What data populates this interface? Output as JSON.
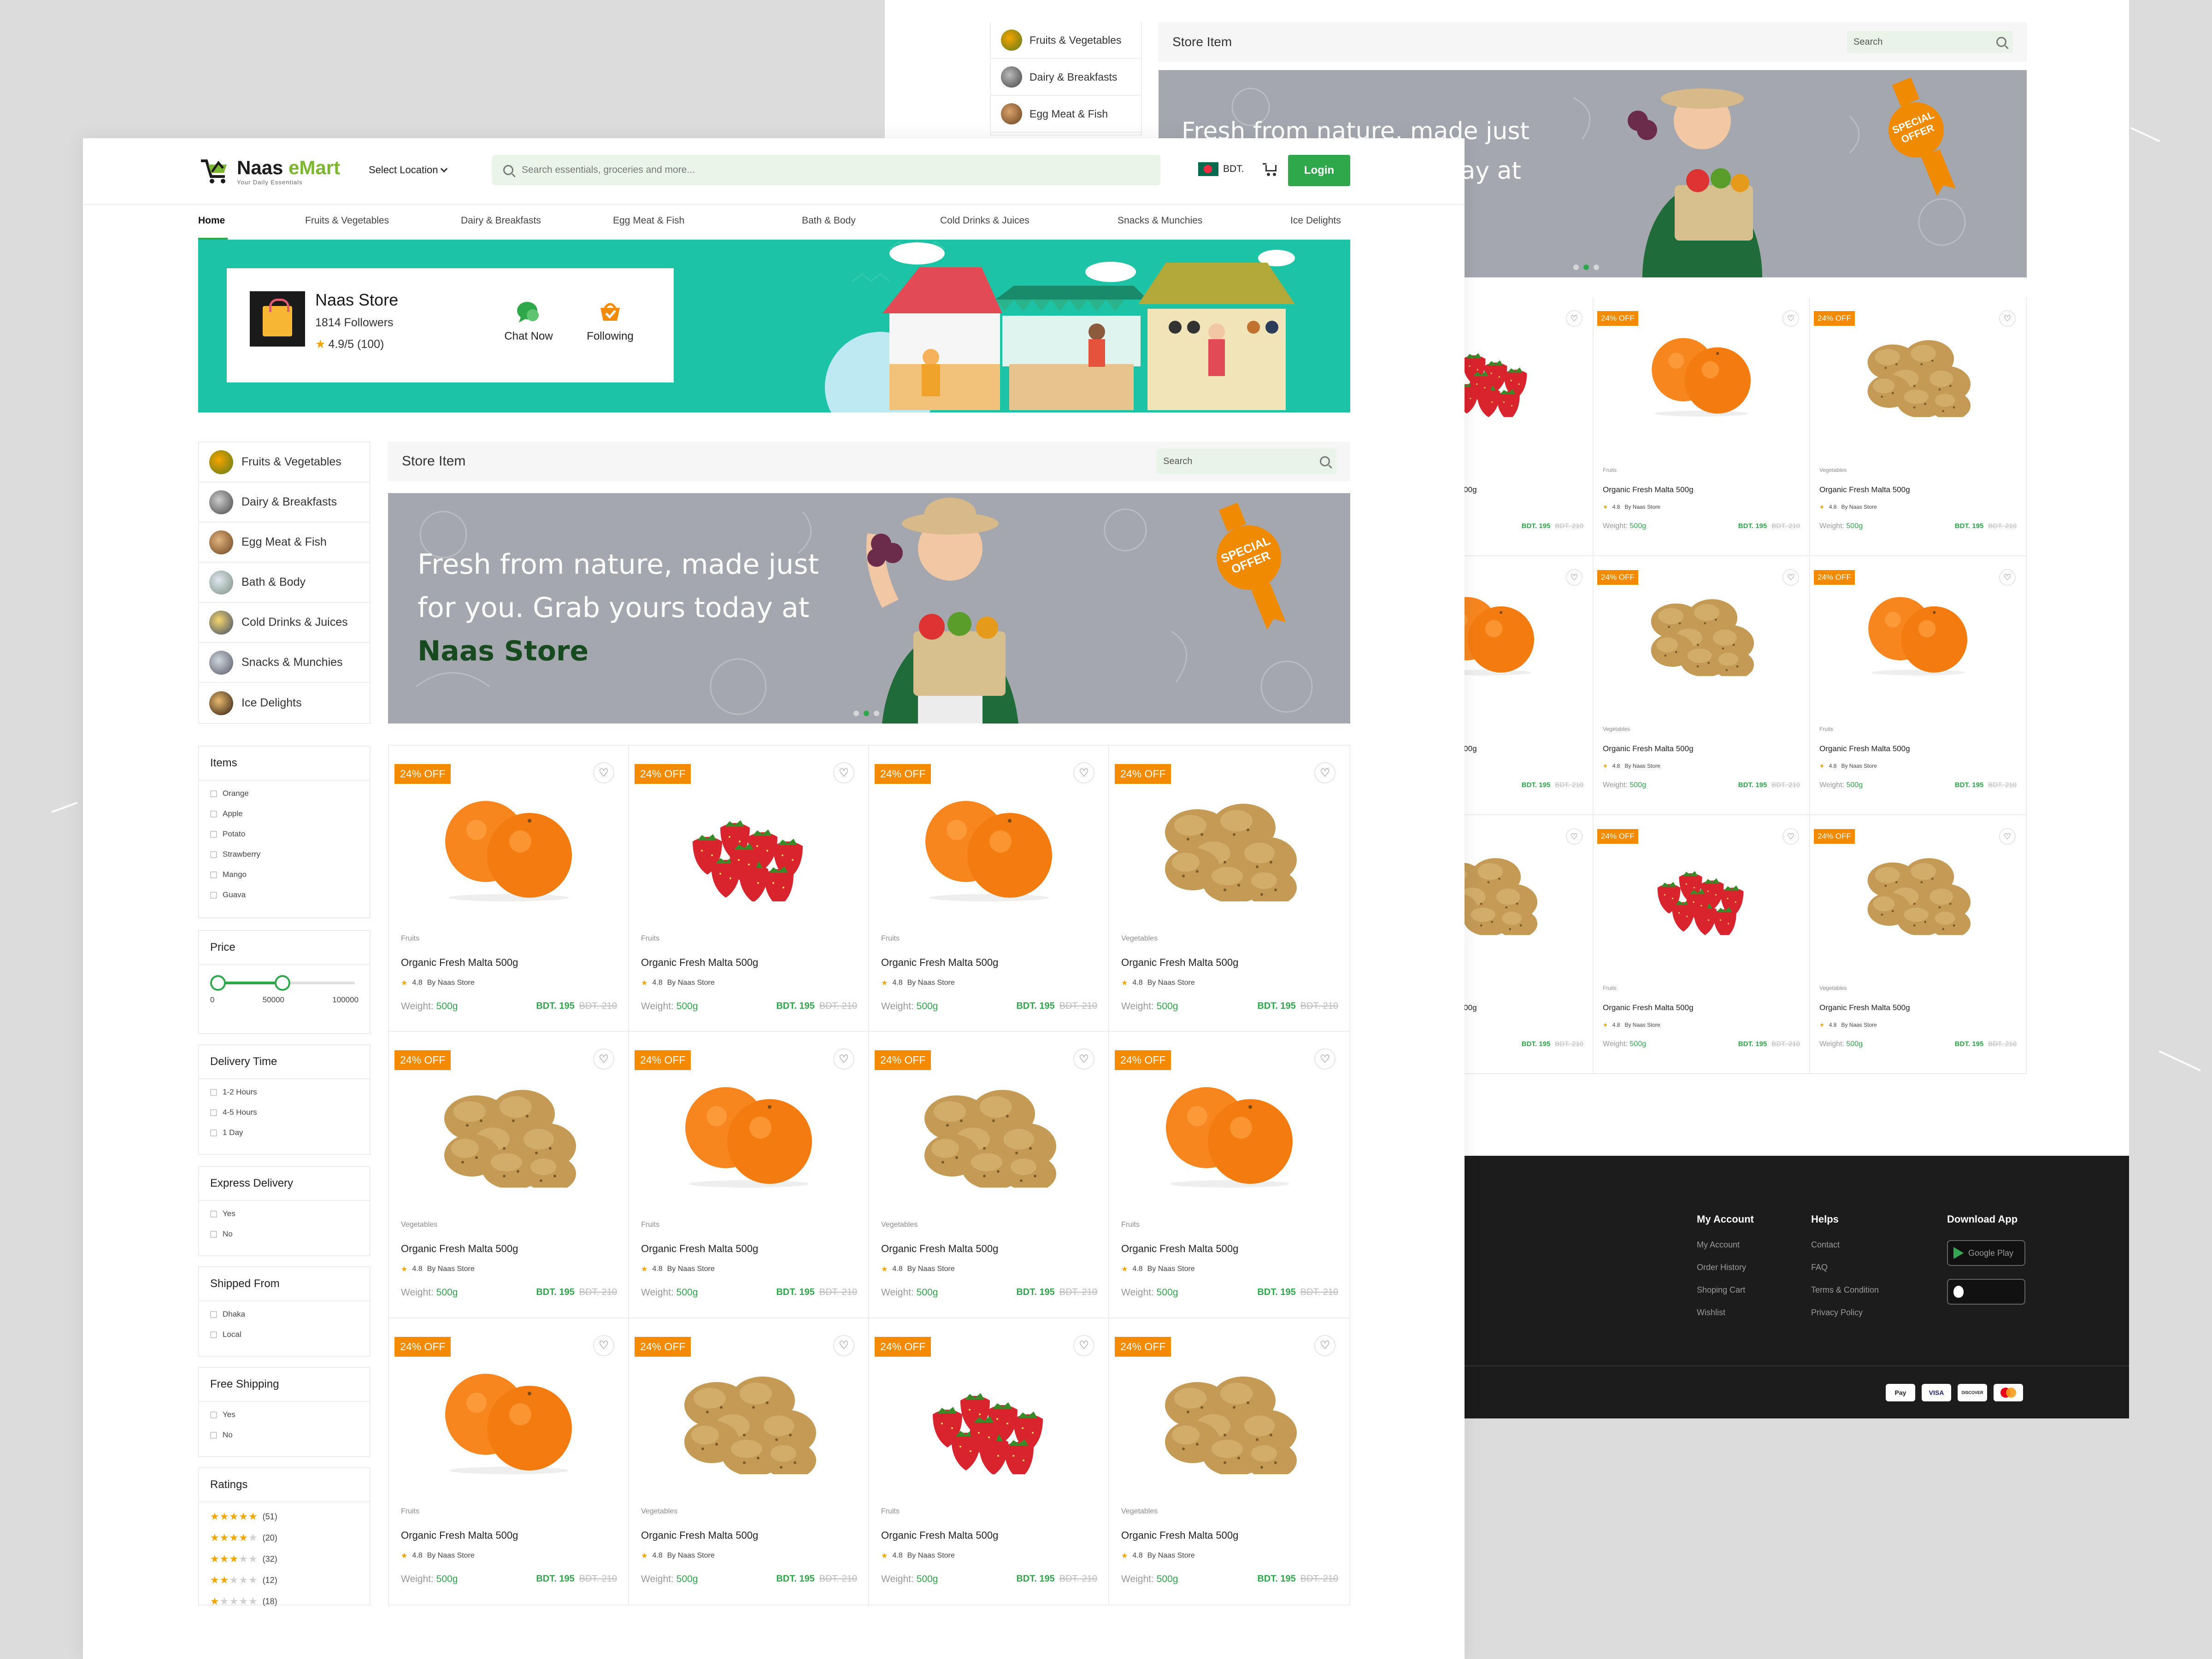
{
  "brand": {
    "name_a": "Naas ",
    "name_b": "eMart",
    "tagline": "Your Daily Essentials"
  },
  "header": {
    "location_label": "Select Location",
    "search_placeholder": "Search essentials, groceries and more...",
    "currency": "BDT.",
    "login_label": "Login"
  },
  "nav": [
    "Home",
    "Fruits & Vegetables",
    "Dairy & Breakfasts",
    "Egg Meat & Fish",
    "Bath & Body",
    "Cold Drinks & Juices",
    "Snacks & Munchies",
    "Ice Delights"
  ],
  "store": {
    "name": "Naas Store",
    "followers": "1814 Followers",
    "rating": "4.9/5 (100)",
    "chat_label": "Chat Now",
    "following_label": "Following"
  },
  "categories": [
    "Fruits & Vegetables",
    "Dairy & Breakfasts",
    "Egg Meat & Fish",
    "Bath & Body",
    "Cold Drinks & Juices",
    "Snacks & Munchies",
    "Ice Delights"
  ],
  "store_items": {
    "title": "Store Item",
    "search_placeholder": "Search"
  },
  "banner": {
    "line1": "Fresh from nature, made just",
    "line2": "for you. Grab yours today at",
    "highlight": "Naas Store",
    "badge_top": "SPECIAL",
    "badge_bottom": "OFFER",
    "slide_count": 3,
    "active_slide": 2
  },
  "filters": {
    "items": {
      "title": "Items",
      "options": [
        "Orange",
        "Apple",
        "Potato",
        "Strawberry",
        "Mango",
        "Guava"
      ]
    },
    "price": {
      "title": "Price",
      "min": "0",
      "mid": "50000",
      "max": "100000",
      "range_selected": [
        0,
        50000
      ]
    },
    "delivery": {
      "title": "Delivery Time",
      "options": [
        "1-2 Hours",
        "4-5 Hours",
        "1 Day"
      ]
    },
    "express": {
      "title": "Express Delivery",
      "options": [
        "Yes",
        "No"
      ]
    },
    "shipped": {
      "title": "Shipped From",
      "options": [
        "Dhaka",
        "Local"
      ]
    },
    "free_shipping": {
      "title": "Free Shipping",
      "options": [
        "Yes",
        "No"
      ]
    },
    "ratings": {
      "title": "Ratings",
      "rows": [
        {
          "stars": 5,
          "count": "(51)"
        },
        {
          "stars": 4,
          "count": "(20)"
        },
        {
          "stars": 3,
          "count": "(32)"
        },
        {
          "stars": 2,
          "count": "(12)"
        },
        {
          "stars": 1,
          "count": "(18)"
        }
      ]
    }
  },
  "product_common": {
    "badge": "24% OFF",
    "name": "Organic Fresh Malta 500g",
    "rating": "4.8",
    "store": "By Naas Store",
    "weight_label": "Weight: ",
    "weight": "500g",
    "price": "BDT. 195",
    "old_price": "BDT. 210"
  },
  "products": [
    {
      "category": "Fruits",
      "image": "orange"
    },
    {
      "category": "Fruits",
      "image": "strawberry"
    },
    {
      "category": "Fruits",
      "image": "orange"
    },
    {
      "category": "Vegetables",
      "image": "potato"
    },
    {
      "category": "Vegetables",
      "image": "potato"
    },
    {
      "category": "Fruits",
      "image": "orange"
    },
    {
      "category": "Vegetables",
      "image": "potato"
    },
    {
      "category": "Fruits",
      "image": "orange"
    },
    {
      "category": "Fruits",
      "image": "orange"
    },
    {
      "category": "Vegetables",
      "image": "potato"
    },
    {
      "category": "Fruits",
      "image": "strawberry"
    },
    {
      "category": "Vegetables",
      "image": "potato"
    }
  ],
  "back_products": [
    {
      "category": "",
      "image": "strawberry"
    },
    {
      "category": "Fruits",
      "image": "orange"
    },
    {
      "category": "Vegetables",
      "image": "potato"
    },
    {
      "category": "",
      "image": "orange"
    },
    {
      "category": "Vegetables",
      "image": "potato"
    },
    {
      "category": "Fruits",
      "image": "orange"
    },
    {
      "category": "",
      "image": "potato"
    },
    {
      "category": "Fruits",
      "image": "strawberry"
    },
    {
      "category": "Vegetables",
      "image": "potato"
    }
  ],
  "footer": {
    "my_account": {
      "title": "My Account",
      "links": [
        "My Account",
        "Order History",
        "Shoping Cart",
        "Wishlist"
      ]
    },
    "helps": {
      "title": "Helps",
      "links": [
        "Contact",
        "FAQ",
        "Terms & Condition",
        "Privacy Policy"
      ]
    },
    "download": {
      "title": "Download App",
      "google": "Google Play"
    },
    "payments": [
      "Pay",
      "VISA",
      "DISCOVER",
      ""
    ]
  },
  "colors": {
    "primary": "#2ea84a",
    "accent": "#f38a00",
    "hero": "#1dc3a5",
    "banner": "#a4a7ad",
    "footer": "#1c1c1c"
  },
  "icons": [
    "search-icon",
    "cart-icon",
    "heart-icon",
    "chat-icon",
    "follow-icon",
    "star-icon",
    "google-play-icon",
    "apple-icon"
  ]
}
